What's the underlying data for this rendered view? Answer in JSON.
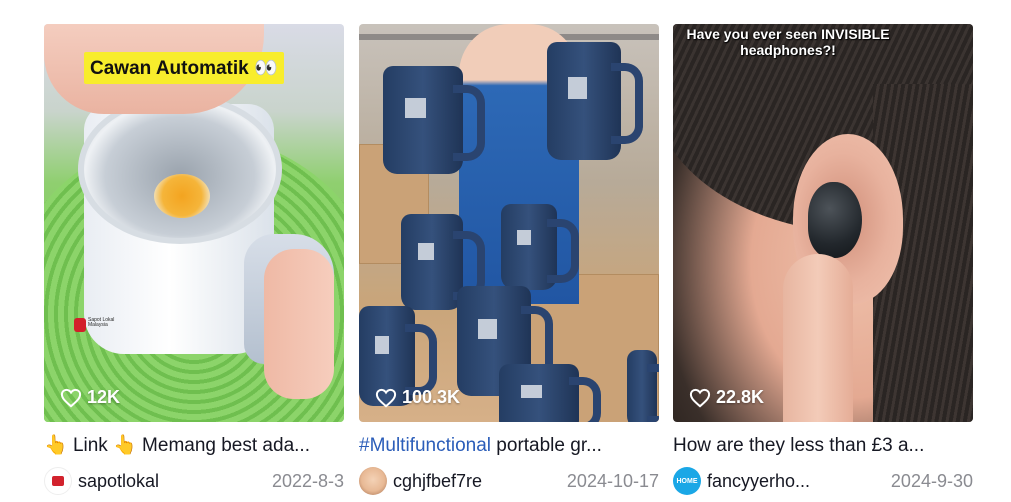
{
  "videos": [
    {
      "overlay_caption": "Cawan Automatik 👀",
      "logo_text": "Sapot Lokal Malaysia",
      "likes": "12K",
      "title_parts": [
        "👆",
        " Link ",
        "👆",
        " Memang best ada..."
      ],
      "username": "sapotlokal",
      "date": "2022-8-3"
    },
    {
      "likes": "100.3K",
      "hashtag": "#Multifunctional",
      "title_rest": " portable gr...",
      "username": "cghjfbef7re",
      "date": "2024-10-17"
    },
    {
      "overlay_caption": "Have you ever seen INVISIBLE headphones?!",
      "likes": "22.8K",
      "title": "How are they less than £3 a...",
      "avatar_text": "HOME",
      "username": "fancyyerho...",
      "date": "2024-9-30"
    }
  ],
  "colors": {
    "hashtag": "#2b5db9",
    "date": "#8a8b91",
    "caption_bg": "#f8ed2c"
  }
}
